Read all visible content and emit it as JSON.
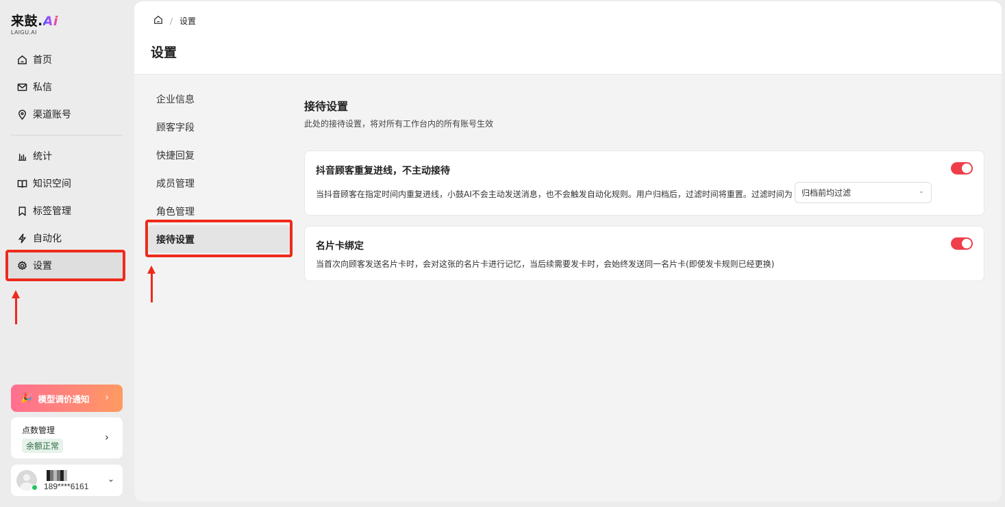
{
  "brand": {
    "name": "来鼓.",
    "ai": "Ai",
    "sub": "LAIGU.AI"
  },
  "sidebar": {
    "group1": [
      {
        "label": "首页",
        "icon": "home-icon"
      },
      {
        "label": "私信",
        "icon": "mail-icon"
      },
      {
        "label": "渠道账号",
        "icon": "location-pin-icon"
      }
    ],
    "group2": [
      {
        "label": "统计",
        "icon": "bar-chart-icon"
      },
      {
        "label": "知识空间",
        "icon": "book-icon"
      },
      {
        "label": "标签管理",
        "icon": "bookmark-icon"
      },
      {
        "label": "自动化",
        "icon": "lightning-icon"
      },
      {
        "label": "设置",
        "icon": "gear-icon",
        "active": true
      }
    ],
    "notice": {
      "emoji": "🎉",
      "label": "模型调价通知"
    },
    "credits": {
      "title": "点数管理",
      "status": "余额正常"
    },
    "user": {
      "phone": "189****6161",
      "status_color": "#22c55e"
    }
  },
  "breadcrumb": {
    "current": "设置"
  },
  "page_title": "设置",
  "subnav": [
    {
      "label": "企业信息"
    },
    {
      "label": "顾客字段"
    },
    {
      "label": "快捷回复"
    },
    {
      "label": "成员管理"
    },
    {
      "label": "角色管理"
    },
    {
      "label": "接待设置",
      "active": true
    }
  ],
  "section": {
    "title": "接待设置",
    "desc": "此处的接待设置，将对所有工作台内的所有账号生效"
  },
  "settings": [
    {
      "title": "抖音顾客重复进线，不主动接待",
      "desc": "当抖音顾客在指定时间内重复进线，小鼓AI不会主动发送消息，也不会触发自动化规则。用户归档后，过滤时间将重置。过滤时间为",
      "select_value": "归档前均过滤",
      "enabled": true
    },
    {
      "title": "名片卡绑定",
      "desc": "当首次向顾客发送名片卡时，会对这张的名片卡进行记忆，当后续需要发卡时，会始终发送同一名片卡(即使发卡规则已经更换)",
      "enabled": true
    }
  ],
  "colors": {
    "accent_red": "#ef3e4a",
    "annotation_red": "#ee2a1c",
    "active_bg": "#dedede"
  }
}
